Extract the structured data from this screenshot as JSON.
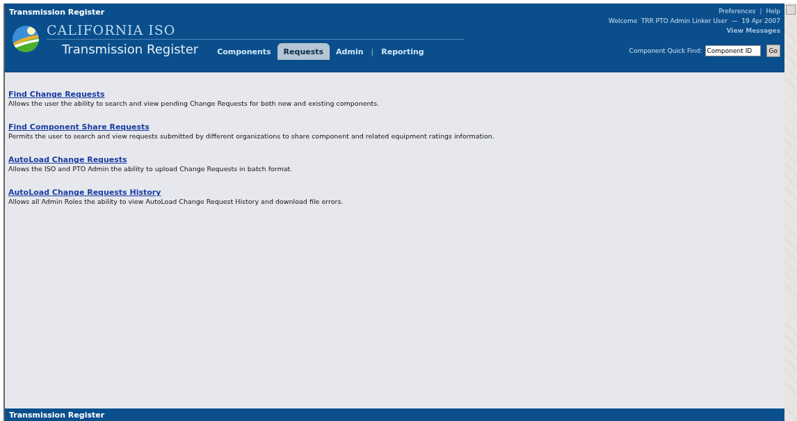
{
  "window": {
    "title": "Transmission Register"
  },
  "header": {
    "brand": "CALIFORNIA ISO",
    "app_title": "Transmission Register",
    "top_links": [
      {
        "kind": "link",
        "label": "Preferences"
      },
      {
        "kind": "separator",
        "label": "|"
      },
      {
        "kind": "link",
        "label": "Help"
      }
    ],
    "welcome": "Welcome  TRR PTO Admin Linker User  —  19 Apr 2007",
    "messages_link": "View Messages",
    "tabs": [
      {
        "kind": "tab",
        "label": "Components",
        "selected": false
      },
      {
        "kind": "tab",
        "label": "Requests",
        "selected": true
      },
      {
        "kind": "tab",
        "label": "Admin",
        "selected": false
      },
      {
        "kind": "separator",
        "label": "|"
      },
      {
        "kind": "tab",
        "label": "Reporting",
        "selected": false
      }
    ],
    "quick_find": {
      "label": "Component Quick Find:",
      "value": "Component ID",
      "button": "Go"
    }
  },
  "items": [
    {
      "link": "Find Change Requests",
      "description": "Allows the user the ability to search and view pending Change Requests for both new and existing components."
    },
    {
      "link": "Find Component Share Requests",
      "description": "Permits the user to search and view requests submitted by different organizations to share component and related equipment ratings information."
    },
    {
      "link": "AutoLoad Change Requests",
      "description": "Allows the ISO and PTO Admin the ability to upload Change Requests in batch format."
    },
    {
      "link": "AutoLoad Change Requests History",
      "description": "Allows all Admin Roles the ability to view AutoLoad Change Request History and download file errors."
    }
  ],
  "status_bar": {
    "text": "Transmission Register"
  }
}
